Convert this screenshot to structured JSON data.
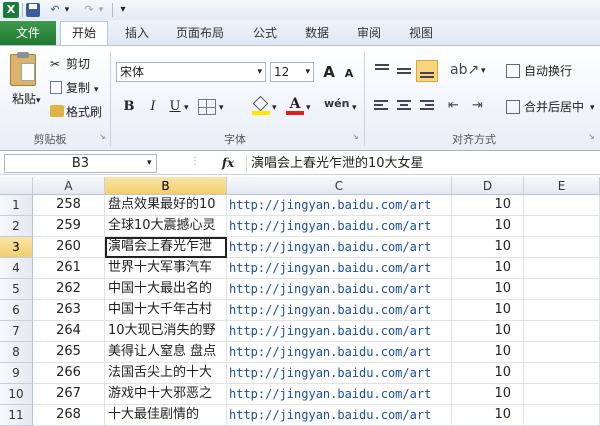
{
  "quick_access": {
    "undo_icon": "↶",
    "redo_icon": "↷",
    "customize_icon": "▾"
  },
  "tabs": [
    "文件",
    "开始",
    "插入",
    "页面布局",
    "公式",
    "数据",
    "审阅",
    "视图"
  ],
  "clipboard": {
    "paste": "粘贴",
    "cut": "剪切",
    "copy": "复制",
    "format_painter": "格式刷",
    "group": "剪贴板"
  },
  "font": {
    "name": "宋体",
    "size": "12",
    "bold": "B",
    "italic": "I",
    "underline": "U",
    "grow": "A",
    "shrink": "A",
    "phonetic": "wén",
    "group": "字体"
  },
  "alignment": {
    "wrap_text": "自动换行",
    "merge_center": "合并后居中",
    "group": "对齐方式"
  },
  "name_box": "B3",
  "formula_icon": "fx",
  "formula_value": "演唱会上春光乍泄的10大女星",
  "columns": [
    "A",
    "B",
    "C",
    "D",
    "E"
  ],
  "rows": [
    {
      "row": "1",
      "a": "258",
      "b": "盘点效果最好的10",
      "c": "http://jingyan.baidu.com/art",
      "d": "10"
    },
    {
      "row": "2",
      "a": "259",
      "b": "全球10大震撼心灵",
      "c": "http://jingyan.baidu.com/art",
      "d": "10"
    },
    {
      "row": "3",
      "a": "260",
      "b": "演唱会上春光乍泄",
      "c": "http://jingyan.baidu.com/art",
      "d": "10"
    },
    {
      "row": "4",
      "a": "261",
      "b": "世界十大军事汽车",
      "c": "http://jingyan.baidu.com/art",
      "d": "10"
    },
    {
      "row": "5",
      "a": "262",
      "b": "中国十大最出名的",
      "c": "http://jingyan.baidu.com/art",
      "d": "10"
    },
    {
      "row": "6",
      "a": "263",
      "b": "中国十大千年古村",
      "c": "http://jingyan.baidu.com/art",
      "d": "10"
    },
    {
      "row": "7",
      "a": "264",
      "b": "10大现已消失的野",
      "c": "http://jingyan.baidu.com/art",
      "d": "10"
    },
    {
      "row": "8",
      "a": "265",
      "b": "美得让人窒息 盘点",
      "c": "http://jingyan.baidu.com/art",
      "d": "10"
    },
    {
      "row": "9",
      "a": "266",
      "b": "法国舌尖上的十大",
      "c": "http://jingyan.baidu.com/art",
      "d": "10"
    },
    {
      "row": "10",
      "a": "267",
      "b": "游戏中十大邪恶之",
      "c": "http://jingyan.baidu.com/art",
      "d": "10"
    },
    {
      "row": "11",
      "a": "268",
      "b": "十大最佳剧情的",
      "c": "http://jingyan.baidu.com/art",
      "d": "10"
    }
  ],
  "colors": {
    "file_tab": "#1f7a30",
    "selection": "#f2cf6e"
  }
}
